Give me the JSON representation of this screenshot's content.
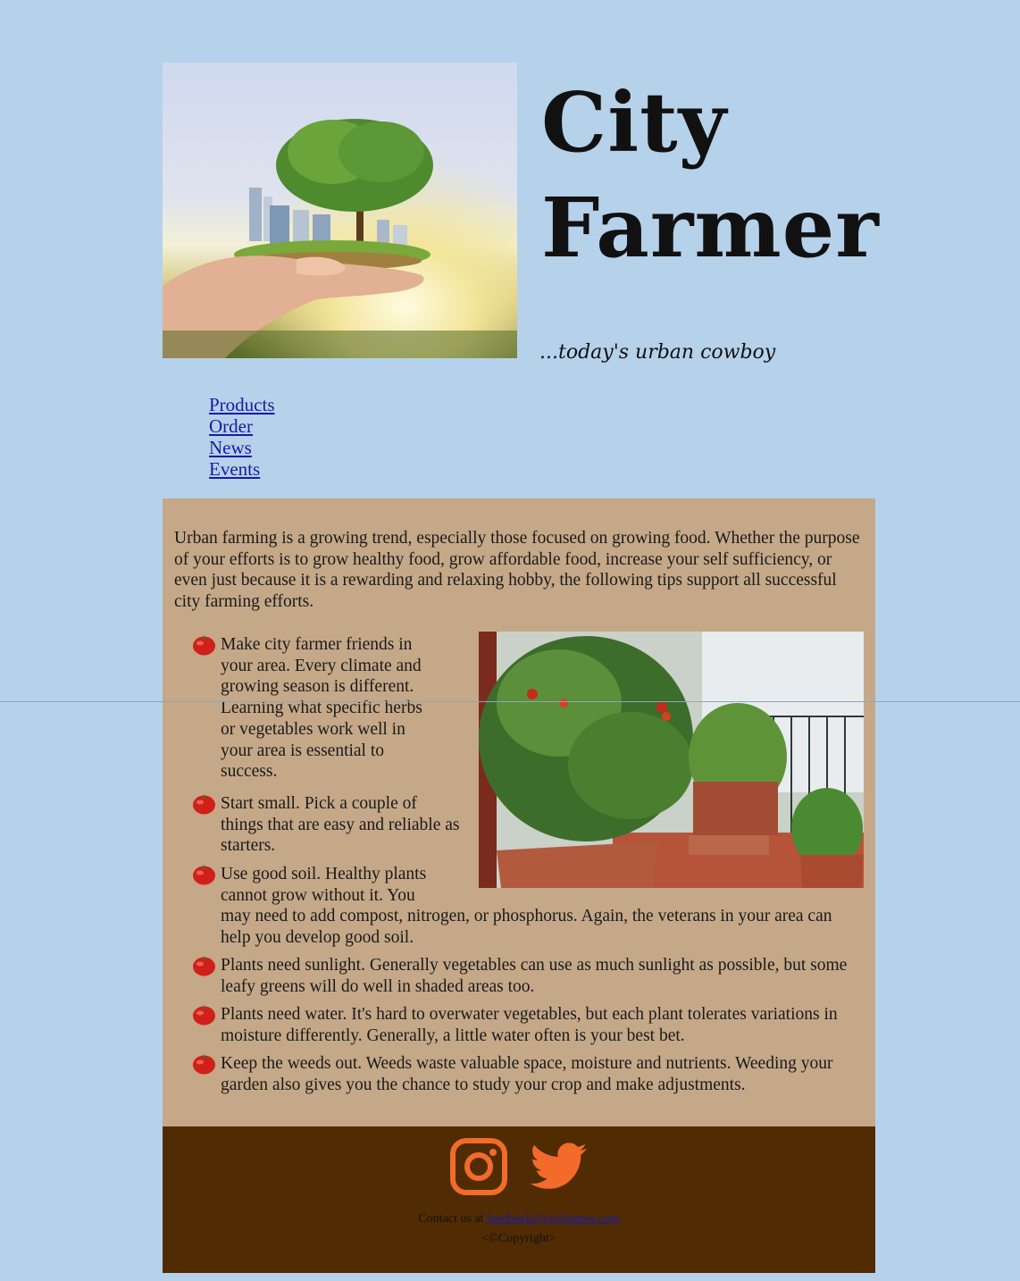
{
  "site": {
    "title_line1": "City",
    "title_line2": "Farmer",
    "tagline": "...today's urban cowboy"
  },
  "nav": {
    "items": [
      {
        "label": "Products"
      },
      {
        "label": "Order"
      },
      {
        "label": "News"
      },
      {
        "label": "Events"
      }
    ]
  },
  "main": {
    "intro": "Urban farming is a growing trend, especially those focused on growing food. Whether the purpose of your efforts is to grow healthy food, grow affordable food, increase your self sufficiency, or even just because it is a rewarding and relaxing hobby, the following tips support all successful city farming efforts.",
    "tips": [
      "Make city farmer friends in your area. Every climate and growing season is different. Learning what specific herbs or vegetables work well in your area is essential to success.",
      "Start small. Pick a couple of things that are easy and reliable as starters.",
      "Use good soil. Healthy plants cannot grow without it. You may need to add compost, nitrogen, or phosphorus. Again, the veterans in your area can help you develop good soil.",
      "Plants need sunlight. Generally vegetables can use as much sunlight as possible, but some leafy greens will do well in shaded areas too.",
      "Plants need water. It's hard to overwater vegetables, but each plant tolerates variations in moisture differently. Generally, a little water often is your best bet.",
      "Keep the weeds out. Weeds waste valuable space, moisture and nutrients. Weeding your garden also gives you the chance to study your crop and make adjustments."
    ]
  },
  "footer": {
    "contact_prefix": "Contact us at ",
    "email": "feedback@cityfarmer.com",
    "copyright": "<©Copyright>"
  },
  "colors": {
    "page_bg": "#b6d1ea",
    "main_bg": "#c4a888",
    "footer_bg": "#512c03",
    "social_icon": "#f26b2b",
    "link": "#1a1aa6"
  },
  "icons": [
    "instagram-icon",
    "twitter-icon",
    "tomato-bullet-icon"
  ]
}
